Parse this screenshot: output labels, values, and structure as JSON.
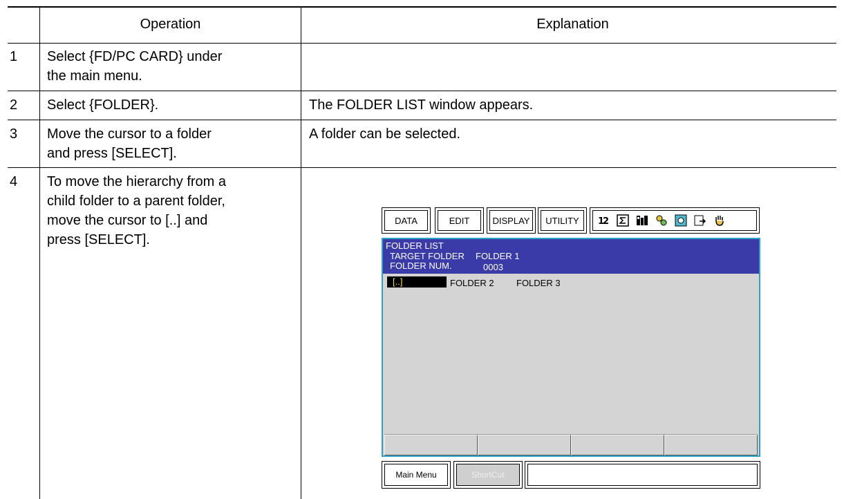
{
  "table": {
    "headers": {
      "operation": "Operation",
      "explanation": "Explanation"
    },
    "rows": [
      {
        "num": "1",
        "operation_lines": [
          "Select {FD/PC CARD} under",
          "the main menu."
        ],
        "explanation": ""
      },
      {
        "num": "2",
        "operation_lines": [
          "Select {FOLDER}."
        ],
        "explanation": "The FOLDER LIST window appears."
      },
      {
        "num": "3",
        "operation_lines": [
          "Move the cursor to a folder",
          "and press [SELECT]."
        ],
        "explanation": "A folder can be selected."
      },
      {
        "num": "4",
        "operation_lines": [
          "To move the hierarchy from a",
          "child folder to a parent folder,",
          "move the cursor to [..] and",
          "press [SELECT]."
        ],
        "explanation": ""
      }
    ]
  },
  "pendant": {
    "menu": {
      "data": "DATA",
      "edit": "EDIT",
      "display": "DISPLAY",
      "utility": "UTILITY"
    },
    "status_icons": [
      "tool-number-icon",
      "sum-icon",
      "mode-icon",
      "running-icon",
      "page-icon",
      "export-icon",
      "hand-icon"
    ],
    "window": {
      "title": "FOLDER LIST",
      "target_label": "TARGET FOLDER",
      "target_value": "FOLDER 1",
      "num_label": "FOLDER NUM.",
      "num_value": "0003"
    },
    "folders": {
      "selected": "[..]",
      "item1": "FOLDER 2",
      "item2": "FOLDER 3"
    },
    "bottom": {
      "main_menu": "Main Menu",
      "shortcut": "ShortCut"
    },
    "colors": {
      "header_band": "#3a3aa8",
      "frame": "#2aa3c4",
      "screen_bg": "#d4d4d4",
      "cursor_text": "#f3e24a"
    }
  }
}
